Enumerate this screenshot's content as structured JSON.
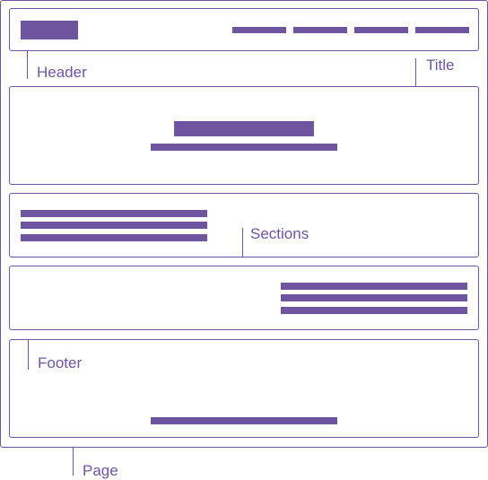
{
  "diagram": {
    "labels": {
      "header": "Header",
      "title": "Title",
      "sections": "Sections",
      "footer": "Footer",
      "page": "Page"
    }
  },
  "colors": {
    "accent": "#6f54a0",
    "background": "#ffffff"
  }
}
